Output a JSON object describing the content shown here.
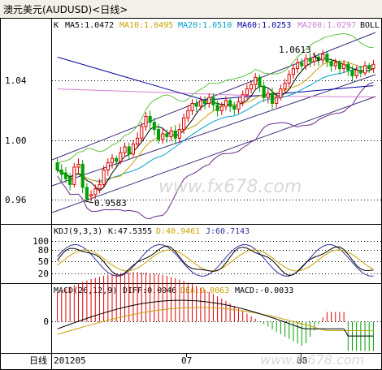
{
  "window_title": "澳元美元(AUDUSD)<日线>",
  "indicators": {
    "k": "K",
    "ma5": "MA5:1.0472",
    "ma10": "MA10:1.0495",
    "ma20": "MA20:1.0510",
    "ma60": "MA60:1.0253",
    "ma200": "MA200:1.0297",
    "boll": "BOLL"
  },
  "kdj": {
    "label": "KDJ(9,3,3)",
    "k": "K:47.5355",
    "d": "D:40.9461",
    "j": "J:60.7143",
    "ticks": [
      "100",
      "80",
      "50",
      "20"
    ]
  },
  "macd": {
    "label": "MACD(26,12,9)",
    "diff": "DIFF:0.0046",
    "dea": "DEA:0.0063",
    "macd": "MACD:-0.0033",
    "zero_tick": "0"
  },
  "axis": {
    "x_label": "日线",
    "x_ticks": [
      "201205",
      "07",
      "08"
    ]
  },
  "annotations": {
    "high": "1.0613",
    "low": "0.9583"
  },
  "watermark": "www.fx678.com",
  "colors": {
    "bg": "#ffffff",
    "grid": "#000000",
    "k_line": "#000000",
    "ma5": "#000000",
    "ma10": "#c8a000",
    "ma20": "#00a0d0",
    "ma60": "#0000a0",
    "ma200": "#d080d0",
    "boll_upper": "#60c040",
    "boll_lower": "#6a2a8a",
    "channel": "#3a2a7a",
    "candle_up": "#e00000",
    "candle_down": "#00a000",
    "kdj_k": "#000000",
    "kdj_d": "#c8a000",
    "kdj_j": "#3030a0",
    "macd_diff": "#000000",
    "macd_dea": "#c8a000"
  },
  "chart_data": {
    "type": "candlestick",
    "title": "澳元美元(AUDUSD)<日线>",
    "ylim": [
      0.945,
      1.075
    ],
    "y_ticks": [
      0.96,
      1.0,
      1.04
    ],
    "grid": true,
    "x": [
      "201205",
      "07",
      "08"
    ],
    "high_label": 1.0613,
    "low_label": 0.9583,
    "series": [
      {
        "name": "MA5",
        "last": 1.0472
      },
      {
        "name": "MA10",
        "last": 1.0495
      },
      {
        "name": "MA20",
        "last": 1.051
      },
      {
        "name": "MA60",
        "last": 1.0253
      },
      {
        "name": "MA200",
        "last": 1.0297
      }
    ],
    "candles": [
      [
        0.985,
        0.98,
        0.978,
        0.988
      ],
      [
        0.98,
        0.977,
        0.972,
        0.984
      ],
      [
        0.978,
        0.974,
        0.971,
        0.982
      ],
      [
        0.975,
        0.97,
        0.966,
        0.978
      ],
      [
        0.97,
        0.982,
        0.968,
        0.985
      ],
      [
        0.982,
        0.984,
        0.978,
        0.988
      ],
      [
        0.984,
        0.968,
        0.964,
        0.987
      ],
      [
        0.968,
        0.96,
        0.958,
        0.971
      ],
      [
        0.962,
        0.963,
        0.9583,
        0.966
      ],
      [
        0.963,
        0.967,
        0.96,
        0.97
      ],
      [
        0.967,
        0.97,
        0.964,
        0.974
      ],
      [
        0.97,
        0.98,
        0.968,
        0.983
      ],
      [
        0.98,
        0.985,
        0.976,
        0.988
      ],
      [
        0.985,
        0.988,
        0.981,
        0.991
      ],
      [
        0.988,
        0.986,
        0.982,
        0.99
      ],
      [
        0.986,
        0.992,
        0.984,
        0.996
      ],
      [
        0.992,
        0.996,
        0.989,
        0.999
      ],
      [
        0.996,
        0.991,
        0.987,
        0.999
      ],
      [
        0.991,
        0.998,
        0.989,
        1.001
      ],
      [
        0.998,
        1.002,
        0.995,
        1.006
      ],
      [
        1.002,
        1.01,
        0.999,
        1.013
      ],
      [
        1.01,
        1.017,
        1.007,
        1.02
      ],
      [
        1.017,
        1.013,
        1.008,
        1.021
      ],
      [
        1.013,
        1.008,
        1.004,
        1.016
      ],
      [
        1.008,
        1.001,
        0.998,
        1.012
      ],
      [
        1.001,
        1.005,
        0.998,
        1.009
      ],
      [
        1.005,
        1.003,
        0.999,
        1.008
      ],
      [
        1.003,
        1.007,
        1.0,
        1.01
      ],
      [
        1.007,
        1.002,
        0.998,
        1.011
      ],
      [
        1.002,
        1.008,
        0.999,
        1.012
      ],
      [
        1.008,
        1.016,
        1.005,
        1.019
      ],
      [
        1.016,
        1.021,
        1.013,
        1.025
      ],
      [
        1.021,
        1.026,
        1.018,
        1.029
      ],
      [
        1.026,
        1.024,
        1.02,
        1.029
      ],
      [
        1.024,
        1.028,
        1.021,
        1.031
      ],
      [
        1.028,
        1.026,
        1.022,
        1.031
      ],
      [
        1.026,
        1.03,
        1.023,
        1.033
      ],
      [
        1.03,
        1.025,
        1.021,
        1.033
      ],
      [
        1.025,
        1.021,
        1.017,
        1.028
      ],
      [
        1.021,
        1.024,
        1.018,
        1.027
      ],
      [
        1.024,
        1.028,
        1.021,
        1.031
      ],
      [
        1.028,
        1.024,
        1.02,
        1.03
      ],
      [
        1.024,
        1.022,
        1.018,
        1.027
      ],
      [
        1.022,
        1.027,
        1.019,
        1.03
      ],
      [
        1.027,
        1.032,
        1.024,
        1.035
      ],
      [
        1.032,
        1.036,
        1.029,
        1.039
      ],
      [
        1.036,
        1.039,
        1.033,
        1.042
      ],
      [
        1.039,
        1.044,
        1.036,
        1.047
      ],
      [
        1.044,
        1.038,
        1.034,
        1.046
      ],
      [
        1.038,
        1.03,
        1.027,
        1.041
      ],
      [
        1.03,
        1.033,
        1.026,
        1.036
      ],
      [
        1.033,
        1.026,
        1.022,
        1.037
      ],
      [
        1.026,
        1.03,
        1.023,
        1.033
      ],
      [
        1.03,
        1.036,
        1.028,
        1.039
      ],
      [
        1.036,
        1.04,
        1.033,
        1.043
      ],
      [
        1.04,
        1.046,
        1.037,
        1.049
      ],
      [
        1.046,
        1.05,
        1.043,
        1.053
      ],
      [
        1.05,
        1.054,
        1.047,
        1.057
      ],
      [
        1.054,
        1.052,
        1.048,
        1.057
      ],
      [
        1.052,
        1.057,
        1.049,
        1.06
      ],
      [
        1.057,
        1.055,
        1.051,
        1.061
      ],
      [
        1.055,
        1.058,
        1.052,
        1.0613
      ],
      [
        1.058,
        1.056,
        1.052,
        1.061
      ],
      [
        1.056,
        1.06,
        1.053,
        1.063
      ],
      [
        1.06,
        1.055,
        1.051,
        1.062
      ],
      [
        1.055,
        1.052,
        1.048,
        1.057
      ],
      [
        1.052,
        1.054,
        1.049,
        1.057
      ],
      [
        1.054,
        1.05,
        1.046,
        1.056
      ],
      [
        1.05,
        1.053,
        1.047,
        1.056
      ],
      [
        1.053,
        1.049,
        1.045,
        1.055
      ],
      [
        1.049,
        1.045,
        1.041,
        1.052
      ],
      [
        1.045,
        1.049,
        1.043,
        1.052
      ],
      [
        1.049,
        1.047,
        1.044,
        1.052
      ],
      [
        1.047,
        1.052,
        1.045,
        1.055
      ],
      [
        1.052,
        1.05,
        1.047,
        1.054
      ],
      [
        1.05,
        1.053,
        1.047,
        1.056
      ]
    ]
  }
}
